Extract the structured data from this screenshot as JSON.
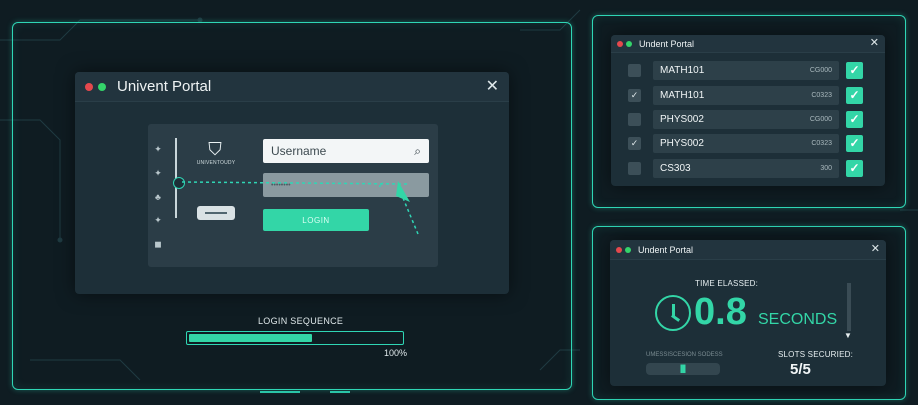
{
  "main_window": {
    "title": "Univent Portal",
    "brand_text": "UNIVENTOUDY",
    "username_placeholder": "Username",
    "password_value": "••••••••",
    "login_label": "LOGIN",
    "side_icons": [
      "✦",
      "✦",
      "♣",
      "✦",
      "◼"
    ]
  },
  "login_sequence": {
    "label": "LOGIN SEQUENCE",
    "progress": 0.58,
    "percent_text": "100%"
  },
  "courses_window": {
    "title": "Undent Portal",
    "rows": [
      {
        "check": "",
        "name": "MATH101",
        "code": "CG000"
      },
      {
        "check": "✓",
        "name": "MATH101",
        "code": "C0323"
      },
      {
        "check": "",
        "name": "PHYS002",
        "code": "CG000"
      },
      {
        "check": "✓",
        "name": "PHYS002",
        "code": "C0323"
      },
      {
        "check": "",
        "name": "CS303",
        "code": "300"
      }
    ]
  },
  "timer_window": {
    "title": "Undent Portal",
    "elapsed_label": "TIME ELASSED:",
    "time_value": "0.8",
    "time_unit": "SECONDS",
    "small_label": "UMESSISCESION SODESS",
    "small_bar_text": "▐▌",
    "slots_label": "SLOTS SECURIED:",
    "slots_value": "5/5"
  },
  "colors": {
    "accent": "#33d6a7",
    "background": "#0f1c22",
    "window": "#1d2f38"
  }
}
